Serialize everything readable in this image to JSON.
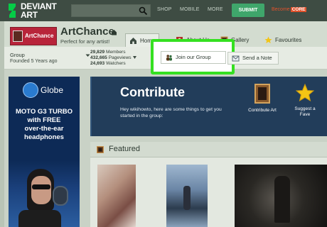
{
  "topbar": {
    "logo_line1": "DEVIANT",
    "logo_line2": "ART",
    "search_placeholder": "",
    "nav": [
      "SHOP",
      "MOBILE",
      "MORE"
    ],
    "submit_label": "SUBMIT",
    "become_label": "Become",
    "core_label": "CORE"
  },
  "group": {
    "avatar_label": "ArtChance",
    "title": "ArtChance",
    "tagline": "Perfect for any artist!",
    "tabs": [
      {
        "label": "Home",
        "icon": "home-icon",
        "active": true
      },
      {
        "label": "About Us",
        "icon": "info-icon",
        "active": false
      },
      {
        "label": "Gallery",
        "icon": "gallery-icon",
        "active": false
      },
      {
        "label": "Favourites",
        "icon": "star-icon",
        "active": false
      }
    ],
    "type_label": "Group",
    "founded": "Founded 5 Years ago",
    "stats": {
      "members": "29,829",
      "members_label": "Members",
      "pageviews": "432,665",
      "pageviews_label": "Pageviews",
      "watchers": "24,693",
      "watchers_label": "Watchers"
    },
    "join_label": "Join our Group",
    "note_label": "Send a Note"
  },
  "ad": {
    "brand": "Globe",
    "lines": [
      "MOTO G3 TURBO",
      "with FREE",
      "over-the-ear",
      "headphones"
    ]
  },
  "contribute": {
    "title": "Contribute",
    "description": "Hey wikihowto, here are some things to get you started in the group:",
    "actions": [
      {
        "label": "Contribute Art",
        "icon": "frame-icon"
      },
      {
        "label": "Suggest a Fave",
        "icon": "star-icon"
      }
    ]
  },
  "featured": {
    "title": "Featured"
  },
  "colors": {
    "topbar": "#3e4c43",
    "submit": "#3fa66b",
    "core": "#e0522c",
    "highlight": "#35e021",
    "contribute_bg": "#223d5a",
    "avatar": "#b8243a"
  }
}
